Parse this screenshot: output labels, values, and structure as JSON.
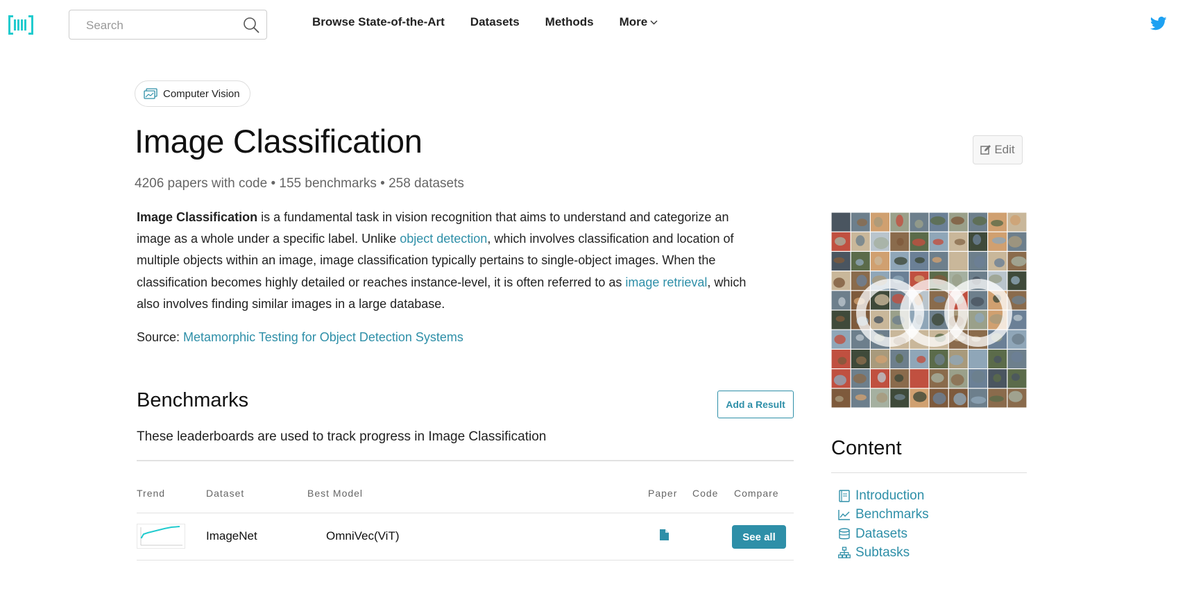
{
  "header": {
    "search_placeholder": "Search",
    "nav": [
      "Browse State-of-the-Art",
      "Datasets",
      "Methods",
      "More"
    ],
    "accent_color": "#21cbce"
  },
  "area": {
    "label": "Computer Vision"
  },
  "page": {
    "title": "Image Classification",
    "edit_label": "Edit",
    "stats": "4206 papers with code • 155 benchmarks • 258 datasets"
  },
  "description": {
    "bold": "Image Classification",
    "p1": " is a fundamental task in vision recognition that aims to understand and categorize an image as a whole under a specific label. Unlike ",
    "link1": "object detection",
    "p2": ", which involves classification and location of multiple objects within an image, image classification typically pertains to single-object images. When the classification becomes highly detailed or reaches instance-level, it is often referred to as ",
    "link2": "image retrieval",
    "p3": ", which also involves finding similar images in a large database.",
    "source_label": "Source: ",
    "source_link": "Metamorphic Testing for Object Detection Systems"
  },
  "benchmarks": {
    "title": "Benchmarks",
    "add_result": "Add a Result",
    "subtitle": "These leaderboards are used to track progress in Image Classification",
    "columns": [
      "Trend",
      "Dataset",
      "Best Model",
      "Paper",
      "Code",
      "Compare"
    ],
    "rows": [
      {
        "dataset": "ImageNet",
        "best_model": "OmniVec(ViT)",
        "compare": "See all"
      }
    ]
  },
  "content": {
    "title": "Content",
    "items": [
      "Introduction",
      "Benchmarks",
      "Datasets",
      "Subtasks"
    ]
  },
  "colors": {
    "link": "#2e8fa8",
    "twitter": "#1da1f2"
  }
}
